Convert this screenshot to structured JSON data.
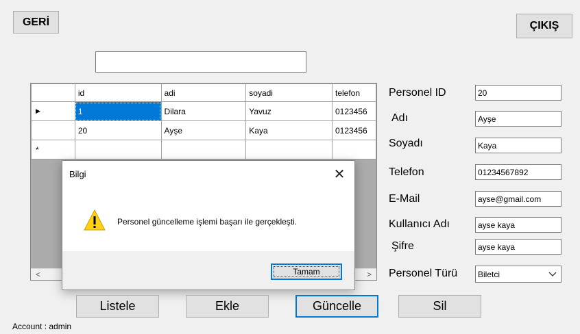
{
  "nav": {
    "back_label": "GERİ",
    "exit_label": "ÇIKIŞ"
  },
  "search": {
    "value": ""
  },
  "grid": {
    "columns": [
      "id",
      "adi",
      "soyadi",
      "telefon"
    ],
    "rows": [
      {
        "marker": "▶",
        "id": "1",
        "adi": "Dilara",
        "soyadi": "Yavuz",
        "telefon": "0123456"
      },
      {
        "marker": "",
        "id": "20",
        "adi": "Ayşe",
        "soyadi": "Kaya",
        "telefon": "0123456"
      },
      {
        "marker": "*",
        "id": "",
        "adi": "",
        "soyadi": "",
        "telefon": ""
      }
    ],
    "scroll_left": "<",
    "scroll_right": ">"
  },
  "dialog": {
    "title": "Bilgi",
    "close": "✕",
    "message": "Personel güncelleme işlemi başarı ile gerçekleşti.",
    "ok_label": "Tamam"
  },
  "form": {
    "id_label": "Personel ID",
    "id_value": "20",
    "name_label": "Adı",
    "name_value": "Ayşe",
    "surname_label": "Soyadı",
    "surname_value": "Kaya",
    "phone_label": "Telefon",
    "phone_value": "01234567892",
    "email_label": "E-Mail",
    "email_value": "ayse@gmail.com",
    "username_label": "Kullanıcı Adı",
    "username_value": "ayse kaya",
    "password_label": "Şifre",
    "password_value": "ayse kaya",
    "type_label": "Personel Türü",
    "type_value": "Biletci"
  },
  "actions": {
    "list": "Listele",
    "add": "Ekle",
    "update": "Güncelle",
    "delete": "Sil"
  },
  "status": {
    "account": "Account : admin"
  },
  "colors": {
    "accent": "#0078d7",
    "warning": "#fcd116",
    "window_bg": "#f0f0f0"
  },
  "icons": {
    "warning": "warning-icon",
    "close": "close-icon",
    "dropdown": "chevron-down-icon"
  }
}
